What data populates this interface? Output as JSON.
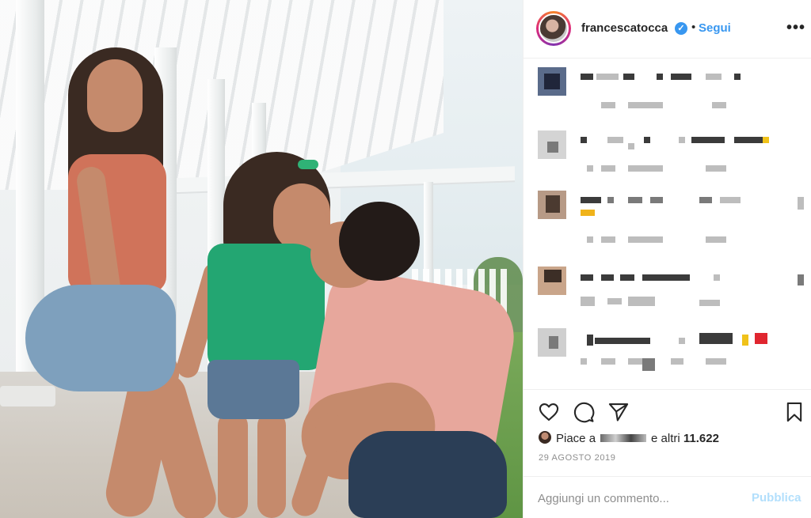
{
  "post": {
    "username": "francescatocca",
    "verified_mark": "✓",
    "separator": "•",
    "follow_label": "Segui",
    "more_label": "•••",
    "likes_prefix": "Piace a",
    "likes_suffix": "e altri",
    "likes_count": "11.622",
    "date": "29 AGOSTO 2019",
    "comment_placeholder": "Aggiungi un commento...",
    "publish_label": "Pubblica"
  },
  "icons": {
    "like": "heart-icon",
    "comment": "comment-bubble-icon",
    "share": "paper-plane-icon",
    "save": "bookmark-icon",
    "verified": "verified-badge-icon",
    "options": "more-options-icon"
  },
  "colors": {
    "link_blue": "#3897f0",
    "publish_disabled": "#b2dffc",
    "meta_gray": "#8e8e8e",
    "divider": "#efefef"
  }
}
